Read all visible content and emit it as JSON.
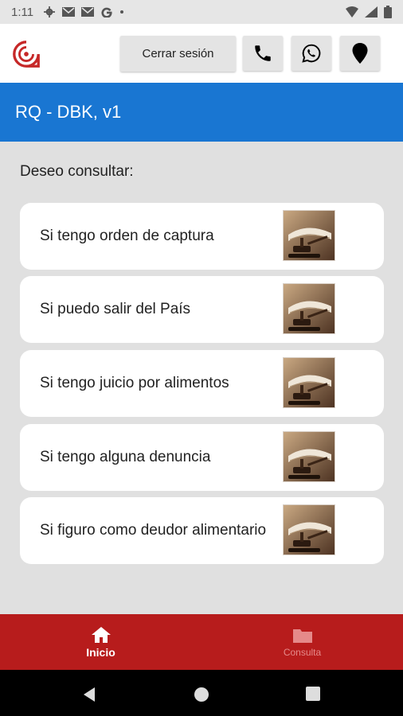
{
  "statusbar": {
    "time": "1:11",
    "icons": [
      "settings-icon",
      "mail-icon",
      "mail-icon",
      "google-icon",
      "dot-icon",
      "wifi-icon",
      "signal-icon",
      "battery-icon"
    ]
  },
  "topbar": {
    "logout_label": "Cerrar sesión",
    "icons": [
      "phone-icon",
      "whatsapp-icon",
      "location-icon"
    ]
  },
  "appbar": {
    "title": "RQ - DBK, v1"
  },
  "main": {
    "prompt": "Deseo consultar:",
    "options": [
      {
        "label": "Si tengo orden de captura"
      },
      {
        "label": "Si puedo salir del País"
      },
      {
        "label": "Si tengo juicio por alimentos"
      },
      {
        "label": "Si tengo alguna denuncia"
      },
      {
        "label": "Si figuro como deudor alimentario"
      }
    ]
  },
  "bottomnav": {
    "items": [
      {
        "label": "Inicio",
        "icon": "home-icon",
        "active": true
      },
      {
        "label": "Consulta",
        "icon": "folder-icon",
        "active": false
      }
    ]
  },
  "colors": {
    "appbar": "#1976d2",
    "bottomnav": "#b71c1c",
    "background": "#e0e0e0"
  }
}
